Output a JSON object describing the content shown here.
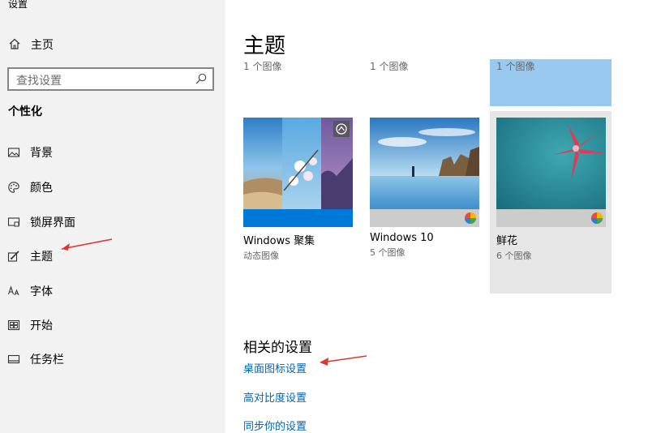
{
  "window": {
    "title": "设置"
  },
  "sidebar": {
    "home_label": "主页",
    "search_placeholder": "查找设置",
    "section_title": "个性化",
    "items": [
      {
        "label": "背景",
        "icon": "image-icon"
      },
      {
        "label": "颜色",
        "icon": "palette-icon"
      },
      {
        "label": "锁屏界面",
        "icon": "lock-screen-icon"
      },
      {
        "label": "主题",
        "icon": "paintbrush-icon"
      },
      {
        "label": "字体",
        "icon": "font-icon"
      },
      {
        "label": "开始",
        "icon": "start-icon"
      },
      {
        "label": "任务栏",
        "icon": "taskbar-icon"
      }
    ]
  },
  "main": {
    "title": "主题",
    "top_row": [
      {
        "sub": "1 个图像"
      },
      {
        "sub": "1 个图像"
      },
      {
        "sub": "1 个图像"
      }
    ],
    "themes": [
      {
        "name": "Windows 聚集",
        "sub": "动态图像"
      },
      {
        "name": "Windows 10",
        "sub": "5 个图像"
      },
      {
        "name": "鲜花",
        "sub": "6 个图像"
      }
    ],
    "related_title": "相关的设置",
    "links": [
      "桌面图标设置",
      "高对比度设置",
      "同步你的设置"
    ]
  },
  "colors": {
    "accent": "#0078d7",
    "link": "#0066b4",
    "annotation_arrow": "#e0362c",
    "sidebar_bg": "#f2f2f2",
    "selected_tile": "#99c9ef"
  }
}
